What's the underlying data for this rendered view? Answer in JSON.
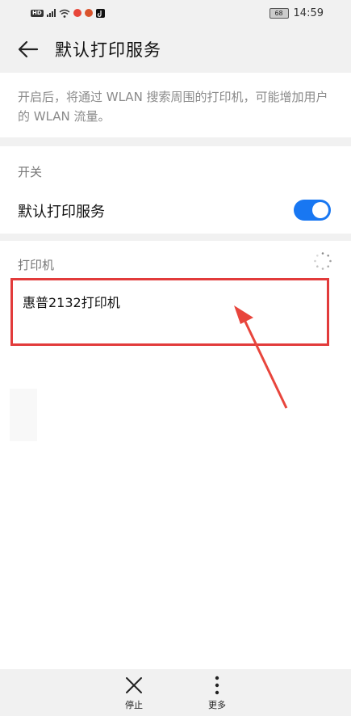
{
  "status_bar": {
    "left_icons": [
      "hd-badge-icon",
      "4g-signal-icon",
      "wifi-icon",
      "app-icon",
      "app-icon",
      "tiktok-icon"
    ],
    "battery_level": "68",
    "time": "14:59"
  },
  "header": {
    "title": "默认打印服务"
  },
  "description": {
    "text": "开启后，将通过 WLAN 搜索周围的打印机，可能增加用户的 WLAN 流量。"
  },
  "switch_section": {
    "label": "开关",
    "item_label": "默认打印服务",
    "enabled": true,
    "accent": "#1877f2"
  },
  "printers_section": {
    "label": "打印机",
    "items": [
      {
        "name": "惠普2132打印机"
      }
    ],
    "highlight_color": "#e23b3b"
  },
  "bottom_bar": {
    "stop_label": "停止",
    "more_label": "更多"
  }
}
